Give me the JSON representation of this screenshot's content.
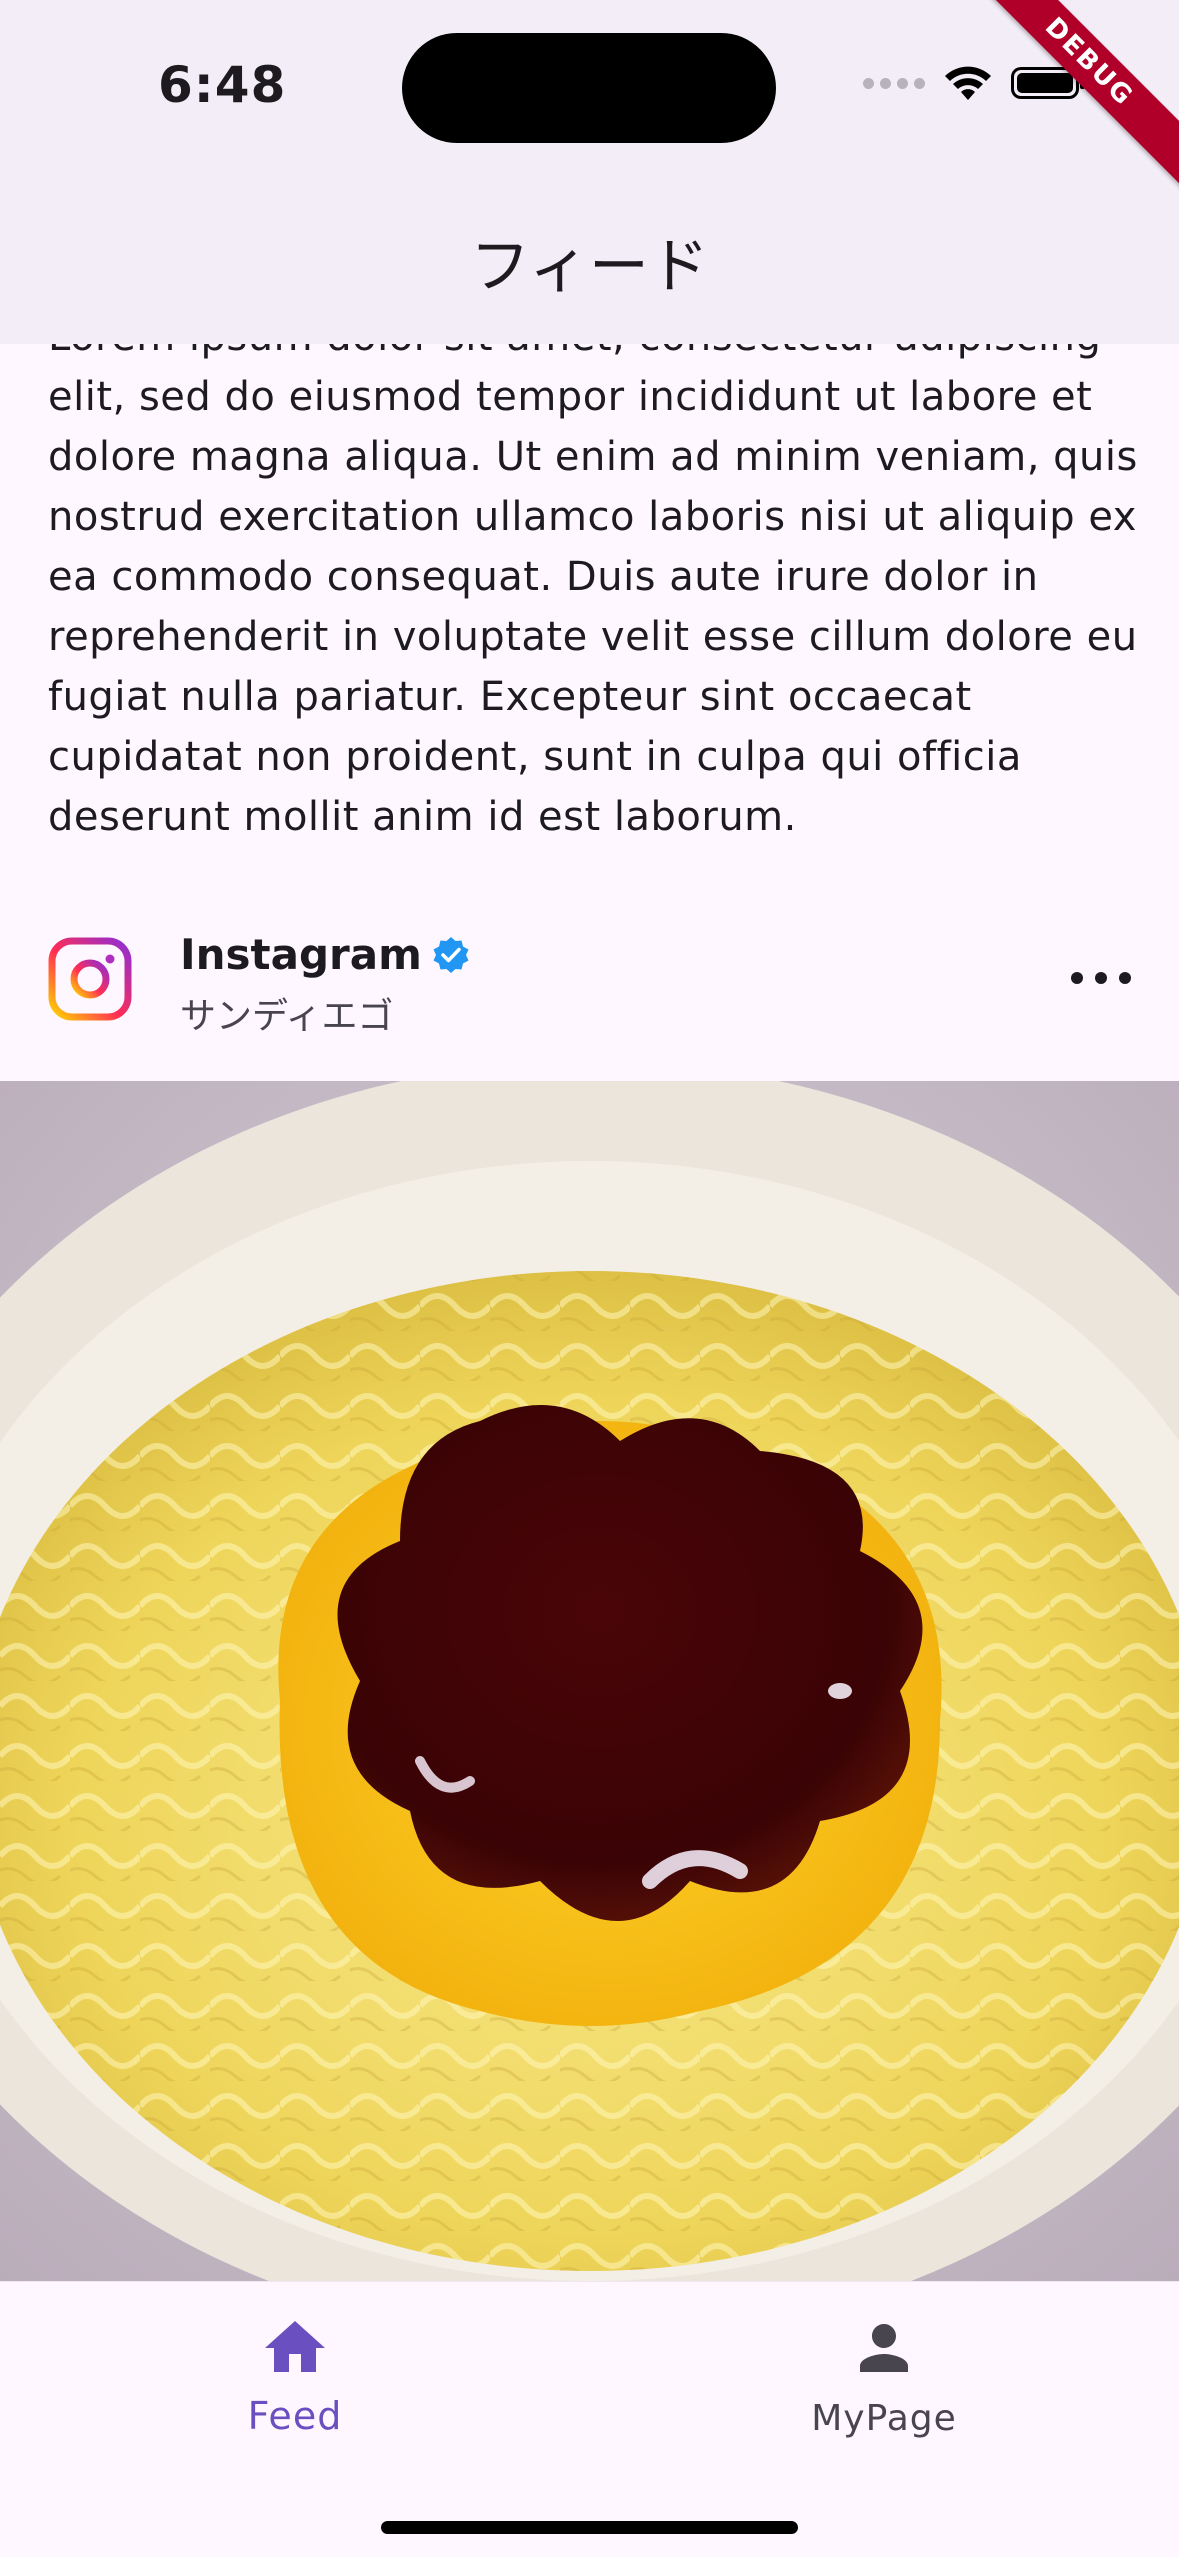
{
  "status_bar": {
    "time": "6:48"
  },
  "debug_banner": "DEBUG",
  "app_bar": {
    "title": "フィード"
  },
  "post": {
    "body": "Lorem ipsum dolor sit amet, consectetur adipiscing elit, sed do eiusmod tempor incididunt ut labore et dolore magna aliqua. Ut enim ad minim veniam, quis nostrud exercitation ullamco laboris nisi ut aliquip ex ea commodo consequat. Duis aute irure dolor in reprehenderit in voluptate velit esse cillum dolore eu fugiat nulla pariatur. Excepteur sint occaecat cupidatat non proident, sunt in culpa qui officia deserunt mollit anim id est laborum.",
    "account_name": "Instagram",
    "location": "サンディエゴ",
    "image_icon": "noodle-bowl-with-pudding"
  },
  "bottom_nav": {
    "items": [
      {
        "label": "Feed",
        "icon": "home-icon",
        "selected": true
      },
      {
        "label": "MyPage",
        "icon": "person-icon",
        "selected": false
      }
    ]
  },
  "colors": {
    "accent": "#6a4fc0",
    "app_bar_bg": "#f3edf7",
    "page_bg": "#fef7ff",
    "verified": "#2196f3",
    "debug": "#b0002a"
  }
}
